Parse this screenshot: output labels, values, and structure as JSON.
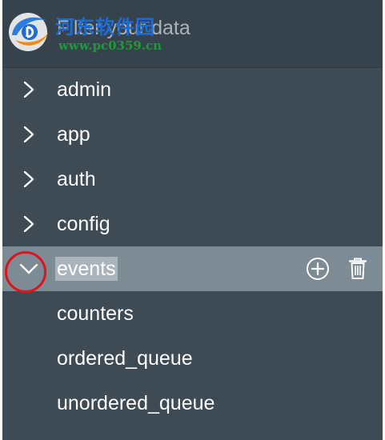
{
  "filter": {
    "placeholder": "Filter your data"
  },
  "watermark": {
    "title": "河东软件园",
    "url": "www.pc0359.cn"
  },
  "tree": {
    "nodes": [
      {
        "label": "admin",
        "expanded": false
      },
      {
        "label": "app",
        "expanded": false
      },
      {
        "label": "auth",
        "expanded": false
      },
      {
        "label": "config",
        "expanded": false
      },
      {
        "label": "events",
        "expanded": true,
        "selected": true,
        "children": [
          {
            "label": "counters"
          },
          {
            "label": "ordered_queue"
          },
          {
            "label": "unordered_queue"
          }
        ]
      }
    ]
  },
  "icons": {
    "collapsed": "chevron-right-icon",
    "expanded": "chevron-down-icon",
    "add": "plus-circle-icon",
    "delete": "trash-icon"
  },
  "colors": {
    "panel": "#3e4b55",
    "filter_bar": "#37434c",
    "selected_row": "#7d8b95",
    "label_highlight": "#aab4ba",
    "annotation": "#e0121b",
    "text": "#ffffff"
  }
}
